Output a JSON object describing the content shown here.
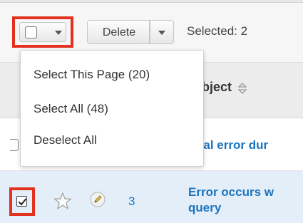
{
  "toolbar": {
    "delete_label": "Delete",
    "selected_text": "Selected: 2"
  },
  "dropdown": {
    "items": [
      {
        "label": "Select This Page (20)"
      },
      {
        "label": "Select All (48)"
      },
      {
        "label": "Deselect All"
      }
    ]
  },
  "table": {
    "subject_header": "ubject",
    "rows": [
      {
        "subject": "ital error dur"
      },
      {
        "number": "3",
        "subject_line1": "Error occurs w",
        "subject_line2": "query",
        "checked": true
      }
    ]
  },
  "colors": {
    "highlight": "#e3311f",
    "link": "#1b74bf",
    "selected_row": "#e3eef9"
  },
  "icons": [
    "checkbox-icon",
    "chevron-down-icon",
    "sort-icon",
    "star-icon",
    "pencil-icon"
  ]
}
